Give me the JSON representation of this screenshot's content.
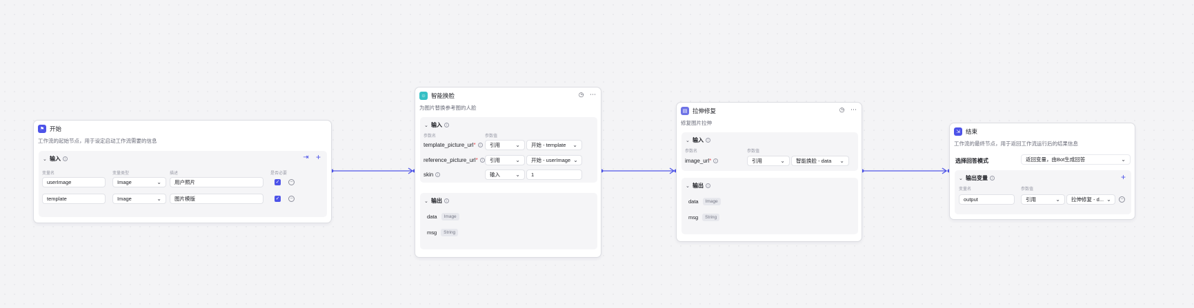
{
  "colors": {
    "accent": "#4d53e8",
    "start_icon": "#4d53e8",
    "faceswap_icon": "#37c0c5",
    "stretch_icon": "#6e73e6",
    "end_icon": "#4d53e8"
  },
  "start_node": {
    "icon": "flag-icon",
    "title": "开始",
    "description": "工作流的起始节点，用于设定启动工作流需要的信息",
    "input_section": {
      "title": "输入",
      "columns": [
        "变量名",
        "变量类型",
        "描述",
        "是否必要"
      ],
      "rows": [
        {
          "name": "userImage",
          "type": "Image",
          "description": "用户照片",
          "required": true
        },
        {
          "name": "template",
          "type": "Image",
          "description": "图片模版",
          "required": true
        }
      ]
    }
  },
  "faceswap_node": {
    "icon": "face-icon",
    "title": "智能换脸",
    "description": "为图片替换参考图的人脸",
    "input_section": {
      "title": "输入",
      "columns": [
        "参数名",
        "参数值"
      ],
      "rows": [
        {
          "name": "template_picture_url",
          "required_mark": "*",
          "mode": "引用",
          "value": "开始 - template"
        },
        {
          "name": "reference_picture_url",
          "required_mark": "*",
          "mode": "引用",
          "value": "开始 - userImage"
        },
        {
          "name": "skin",
          "required_mark": "",
          "mode": "输入",
          "value": "1"
        }
      ]
    },
    "output_section": {
      "title": "输出",
      "fields": [
        {
          "name": "data",
          "type": "Image"
        },
        {
          "name": "msg",
          "type": "String"
        }
      ]
    }
  },
  "stretch_node": {
    "icon": "stretch-icon",
    "title": "拉伸修复",
    "description": "修复图片拉伸",
    "input_section": {
      "title": "输入",
      "columns": [
        "参数名",
        "参数值"
      ],
      "rows": [
        {
          "name": "image_url",
          "required_mark": "*",
          "mode": "引用",
          "value": "智能换脸 - data"
        }
      ]
    },
    "output_section": {
      "title": "输出",
      "fields": [
        {
          "name": "data",
          "type": "Image"
        },
        {
          "name": "msg",
          "type": "String"
        }
      ]
    }
  },
  "end_node": {
    "icon": "end-icon",
    "title": "结束",
    "description": "工作流的最终节点，用于返回工作流运行后的结果信息",
    "answer_mode": {
      "label": "选择回答模式",
      "value": "返回变量，由Bot生成回答"
    },
    "output_section": {
      "title": "输出变量",
      "columns": [
        "变量名",
        "参数值"
      ],
      "rows": [
        {
          "name": "output",
          "mode": "引用",
          "value": "拉伸修复 - d..."
        }
      ]
    }
  }
}
